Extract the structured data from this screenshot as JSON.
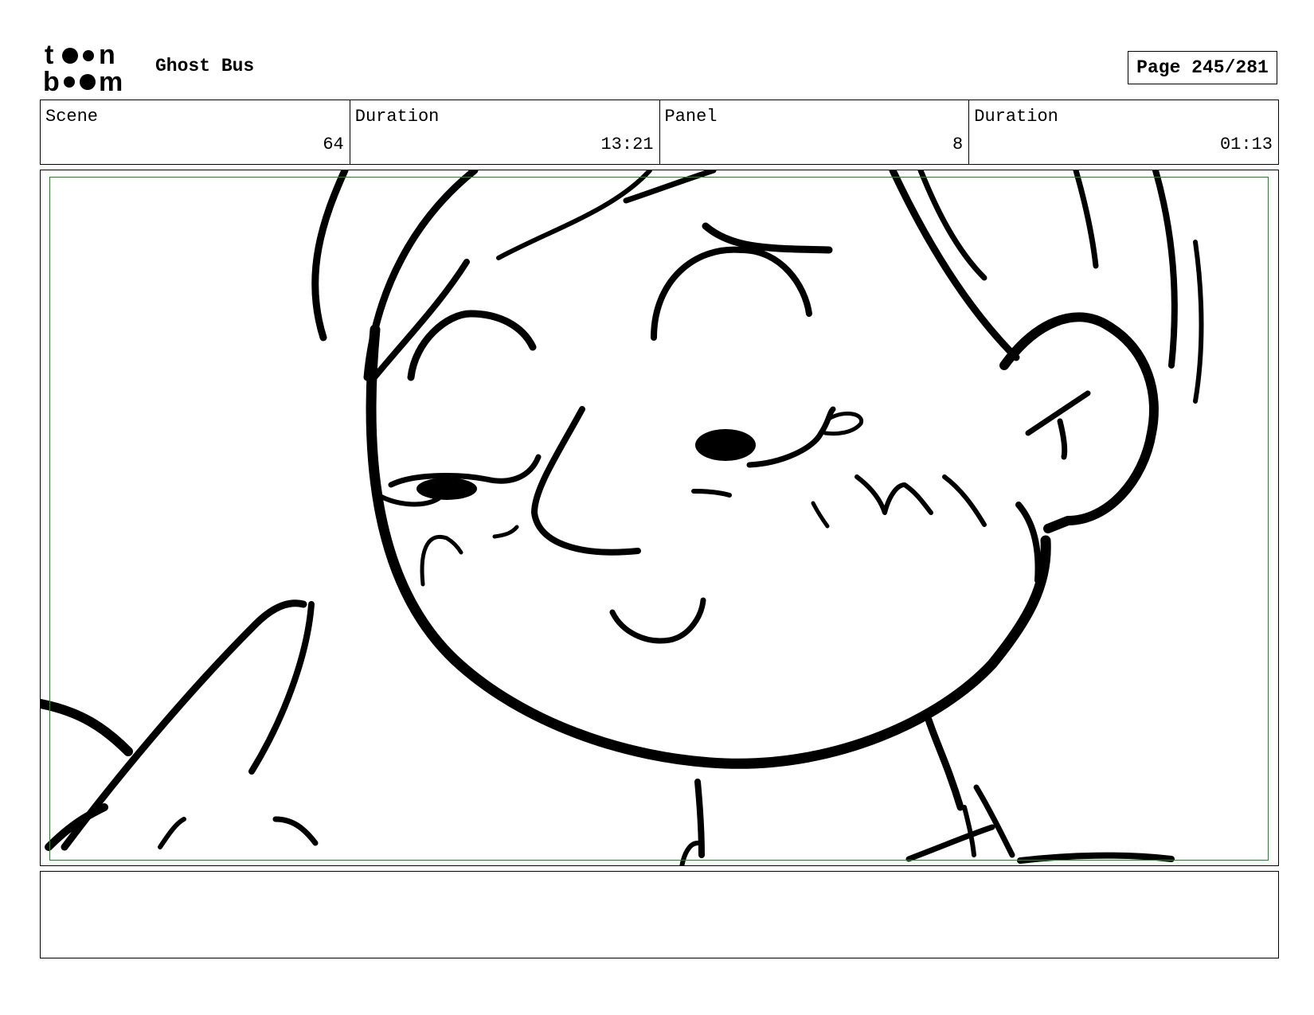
{
  "header": {
    "logo_text_line1": "toon",
    "logo_text_line2": "boom",
    "project_title": "Ghost Bus",
    "page_indicator": "Page 245/281"
  },
  "info": {
    "scene_label": "Scene",
    "scene_value": "64",
    "scene_duration_label": "Duration",
    "scene_duration_value": "13:21",
    "panel_label": "Panel",
    "panel_value": "8",
    "panel_duration_label": "Duration",
    "panel_duration_value": "01:13"
  },
  "notes": {
    "text": ""
  },
  "colors": {
    "safe_frame": "#2e7d32",
    "ink": "#000000"
  }
}
